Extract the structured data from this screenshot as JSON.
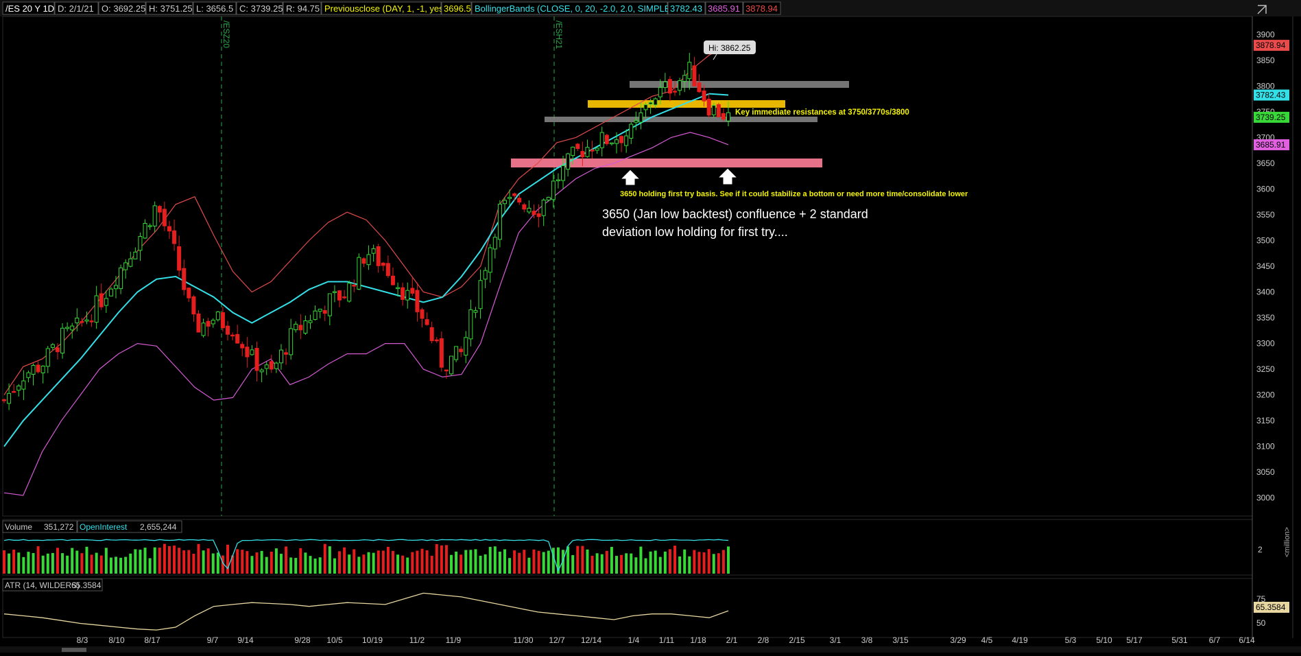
{
  "header": {
    "symbol": "/ES 20 Y 1D",
    "date": "D: 2/1/21",
    "open": "O: 3692.25",
    "high": "H: 3751.25",
    "low": "L: 3656.5",
    "close": "C: 3739.25",
    "range": "R: 94.75",
    "prevclose_label": "Previousclose (DAY, 1, -1, yes)",
    "prevclose_value": "3696.5",
    "bb_label": "BollingerBands (CLOSE, 0, 20, -2.0, 2.0, SIMPLE)",
    "bb_mid": "3782.43",
    "bb_low": "3685.91",
    "bb_up": "3878.94"
  },
  "price_axis": {
    "ticks": [
      "3900",
      "3850",
      "3800",
      "3750",
      "3700",
      "3650",
      "3600",
      "3550",
      "3500",
      "3450",
      "3400",
      "3350",
      "3300",
      "3250",
      "3200",
      "3150",
      "3100",
      "3050",
      "3000"
    ],
    "badges": [
      {
        "label": "3878.94",
        "value": 3878.94,
        "color": "#e94a4a"
      },
      {
        "label": "3782.43",
        "value": 3782.43,
        "color": "#34e0e8"
      },
      {
        "label": "3739.25",
        "value": 3739.25,
        "color": "#37d837"
      },
      {
        "label": "3685.91",
        "value": 3685.91,
        "color": "#e060e0"
      }
    ]
  },
  "contract_markers": [
    "/ESZ20",
    "/ESH21"
  ],
  "annotations": {
    "hi_label": "Hi: 3862.25",
    "resistance_note": "Key immediate resistances at 3750/3770s/3800",
    "support_note": "3650 holding first try basis. See if it could stabilize a bottom or need more time/consolidate lower",
    "main_note_line1": "3650 (Jan low backtest) confluence + 2 standard",
    "main_note_line2": "deviation low holding for first try...."
  },
  "volume_panel": {
    "label": "Volume",
    "value": "351,272",
    "oi_label": "OpenInterest",
    "oi_value": "2,655,244",
    "axis_tick": "2",
    "axis_unit": "<million>"
  },
  "atr_panel": {
    "label": "ATR (14, WILDERS)",
    "value": "65.3584",
    "ticks": [
      "75",
      "50"
    ]
  },
  "x_axis": {
    "ticks": [
      "8/3",
      "8/10",
      "8/17",
      "9/7",
      "9/14",
      "9/28",
      "10/5",
      "10/19",
      "11/2",
      "11/9",
      "11/30",
      "12/7",
      "12/14",
      "1/4",
      "1/11",
      "1/18",
      "2/1",
      "2/8",
      "2/15",
      "3/1",
      "3/8",
      "3/15",
      "3/29",
      "4/5",
      "4/19",
      "5/3",
      "5/10",
      "5/17",
      "5/31",
      "6/7",
      "6/14"
    ]
  },
  "colors": {
    "up": "#37d837",
    "down": "#e61e1e",
    "bb_mid": "#34e0e8",
    "bb_up": "#e14b4b",
    "bb_low": "#d45ad4",
    "zone_pink": "#f2778f",
    "zone_gold": "#e8b800",
    "zone_gray": "#8a8a8a",
    "annotation_yellow": "#f4f400",
    "atr": "#e8d7a0"
  },
  "chart_data": {
    "type": "candlestick",
    "title": "/ES 20 Y 1D",
    "ylim": [
      2965,
      3935
    ],
    "series": [
      {
        "name": "BollingerBands upper",
        "values": [
          3200,
          3255,
          3270,
          3300,
          3340,
          3385,
          3430,
          3480,
          3520,
          3570,
          3585,
          3510,
          3440,
          3400,
          3420,
          3460,
          3500,
          3535,
          3555,
          3540,
          3500,
          3450,
          3400,
          3390,
          3410,
          3450,
          3570,
          3620,
          3650,
          3690,
          3700,
          3720,
          3740,
          3760,
          3780,
          3790,
          3830,
          3860,
          3878.94
        ]
      },
      {
        "name": "BollingerBands middle",
        "values": [
          3100,
          3150,
          3190,
          3230,
          3270,
          3315,
          3360,
          3400,
          3425,
          3430,
          3410,
          3390,
          3360,
          3340,
          3360,
          3380,
          3405,
          3420,
          3420,
          3410,
          3400,
          3390,
          3380,
          3390,
          3430,
          3480,
          3540,
          3590,
          3615,
          3640,
          3660,
          3680,
          3700,
          3720,
          3740,
          3755,
          3770,
          3785,
          3782.43
        ]
      },
      {
        "name": "BollingerBands lower",
        "values": [
          3010,
          3005,
          3090,
          3150,
          3200,
          3250,
          3280,
          3300,
          3295,
          3255,
          3215,
          3190,
          3195,
          3250,
          3270,
          3220,
          3235,
          3260,
          3280,
          3280,
          3300,
          3300,
          3250,
          3235,
          3240,
          3300,
          3410,
          3515,
          3560,
          3590,
          3620,
          3640,
          3650,
          3665,
          3680,
          3700,
          3710,
          3700,
          3685.91
        ]
      },
      {
        "name": "Close",
        "values": [
          3190,
          3240,
          3260,
          3310,
          3335,
          3380,
          3440,
          3500,
          3570,
          3470,
          3330,
          3350,
          3330,
          3270,
          3240,
          3310,
          3350,
          3380,
          3400,
          3480,
          3450,
          3400,
          3350,
          3260,
          3280,
          3420,
          3560,
          3580,
          3560,
          3620,
          3670,
          3690,
          3700,
          3710,
          3780,
          3800,
          3830,
          3760,
          3739.25
        ]
      }
    ],
    "volume": {
      "tick": 2,
      "unit": "million",
      "last": 351272
    },
    "open_interest": 2655244,
    "atr": {
      "ylim": [
        40,
        85
      ],
      "last": 65.3584
    },
    "levels": {
      "resistance": [
        3750,
        3770,
        3800
      ],
      "support": 3650,
      "high": 3862.25
    }
  }
}
